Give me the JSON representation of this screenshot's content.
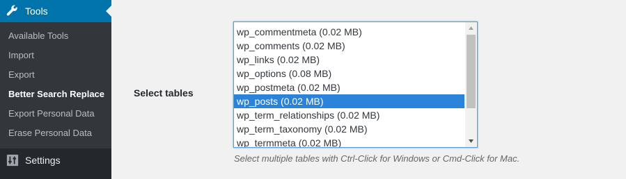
{
  "sidebar": {
    "active_menu": {
      "label": "Tools",
      "icon": "wrench-icon"
    },
    "submenu": [
      {
        "label": "Available Tools",
        "current": false
      },
      {
        "label": "Import",
        "current": false
      },
      {
        "label": "Export",
        "current": false
      },
      {
        "label": "Better Search Replace",
        "current": true
      },
      {
        "label": "Export Personal Data",
        "current": false
      },
      {
        "label": "Erase Personal Data",
        "current": false
      }
    ],
    "next_menu": {
      "label": "Settings",
      "icon": "settings-icon"
    }
  },
  "form": {
    "select_tables_label": "Select tables",
    "tables": [
      {
        "label": "wp_commentmeta (0.02 MB)",
        "selected": false
      },
      {
        "label": "wp_comments (0.02 MB)",
        "selected": false
      },
      {
        "label": "wp_links (0.02 MB)",
        "selected": false
      },
      {
        "label": "wp_options (0.08 MB)",
        "selected": false
      },
      {
        "label": "wp_postmeta (0.02 MB)",
        "selected": false
      },
      {
        "label": "wp_posts (0.02 MB)",
        "selected": true
      },
      {
        "label": "wp_term_relationships (0.02 MB)",
        "selected": false
      },
      {
        "label": "wp_term_taxonomy (0.02 MB)",
        "selected": false
      },
      {
        "label": "wp_termmeta (0.02 MB)",
        "selected": false
      }
    ],
    "help_text": "Select multiple tables with Ctrl-Click for Windows or Cmd-Click for Mac."
  },
  "colors": {
    "menu_active": "#0073aa",
    "sidebar_bg": "#23282d",
    "submenu_bg": "#32373c",
    "selection": "#2b82d9"
  }
}
